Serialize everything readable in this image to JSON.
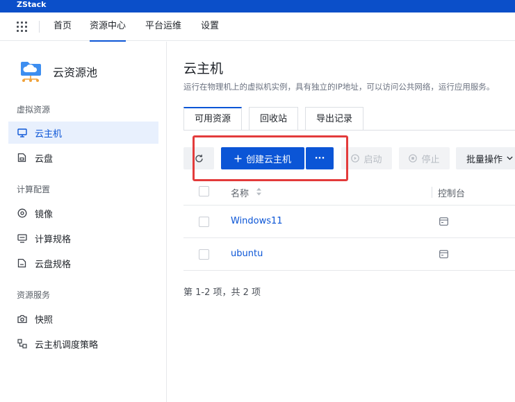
{
  "app": {
    "brand": "ZStack"
  },
  "nav": {
    "items": [
      {
        "label": "首页"
      },
      {
        "label": "资源中心"
      },
      {
        "label": "平台运维"
      },
      {
        "label": "设置"
      }
    ]
  },
  "sidebar": {
    "pool_title": "云资源池",
    "sections": [
      {
        "title": "虚拟资源",
        "items": [
          {
            "label": "云主机"
          },
          {
            "label": "云盘"
          }
        ]
      },
      {
        "title": "计算配置",
        "items": [
          {
            "label": "镜像"
          },
          {
            "label": "计算规格"
          },
          {
            "label": "云盘规格"
          }
        ]
      },
      {
        "title": "资源服务",
        "items": [
          {
            "label": "快照"
          },
          {
            "label": "云主机调度策略"
          }
        ]
      }
    ]
  },
  "main": {
    "title": "云主机",
    "description": "运行在物理机上的虚拟机实例，具有独立的IP地址，可以访问公共网络，运行应用服务。",
    "tabs": [
      {
        "label": "可用资源"
      },
      {
        "label": "回收站"
      },
      {
        "label": "导出记录"
      }
    ],
    "toolbar": {
      "create_label": "创建云主机",
      "more_label": "···",
      "start_label": "启动",
      "stop_label": "停止",
      "batch_label": "批量操作"
    },
    "table": {
      "columns": {
        "name": "名称",
        "console": "控制台"
      },
      "rows": [
        {
          "name": "Windows11"
        },
        {
          "name": "ubuntu"
        }
      ]
    },
    "pagination": "第 1-2 项，共 2 项"
  },
  "colors": {
    "primary": "#0b55d6",
    "brand_bar": "#0b4fc9",
    "highlight": "#e33b3b"
  }
}
